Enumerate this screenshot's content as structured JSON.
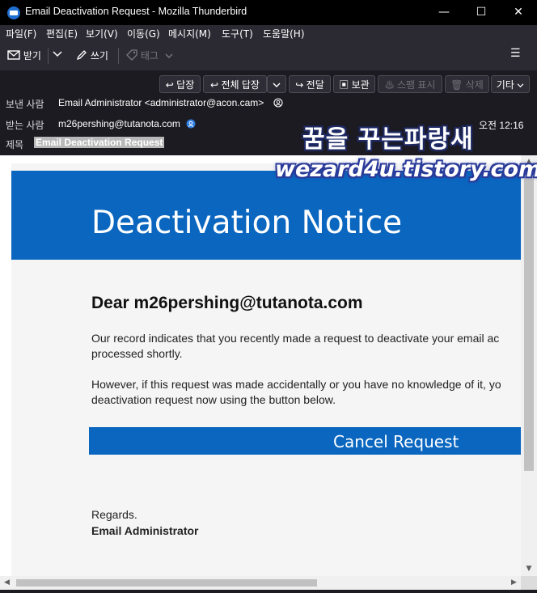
{
  "window": {
    "title": "Email Deactivation Request - Mozilla Thunderbird",
    "minimize": "—",
    "maximize": "☐",
    "close": "✕"
  },
  "menu": [
    "파일(F)",
    "편집(E)",
    "보기(V)",
    "이동(G)",
    "메시지(M)",
    "도구(T)",
    "도움말(H)"
  ],
  "toolbar": {
    "get_mail": "받기",
    "write": "쓰기",
    "tag": "태그",
    "menu_icon": "☰"
  },
  "header_buttons": {
    "reply": "답장",
    "reply_all": "전체 답장",
    "forward": "전달",
    "archive": "보관",
    "junk": "스팸 표시",
    "delete": "삭제",
    "other": "기타"
  },
  "header": {
    "from_label": "보낸 사람",
    "from_value": "Email Administrator <administrator@acon.cam>",
    "to_label": "받는 사람",
    "to_value": "m26pershing@tutanota.com",
    "date": "오전 12:16",
    "subject_label": "제목",
    "subject_value": "Email Deactivation Request"
  },
  "watermark": {
    "line1": "꿈을 꾸는파랑새",
    "line2": "wezard4u.tistory.com"
  },
  "email": {
    "banner_title": "Deactivation Notice",
    "greeting": "Dear m26pershing@tutanota.com",
    "para1_line1": "Our record indicates that you recently made a request to deactivate your email ac",
    "para1_line2": "processed shortly.",
    "para2_line1": "However, if this request was made accidentally or you have no knowledge of it, yo",
    "para2_line2": "deactivation request now using the button below.",
    "button": "Cancel Request",
    "regards": "Regards.",
    "signature": "Email Administrator"
  },
  "colors": {
    "banner_blue": "#0a66bf",
    "chrome_dark": "#2b2a33",
    "header_bg": "#1c1b22"
  }
}
